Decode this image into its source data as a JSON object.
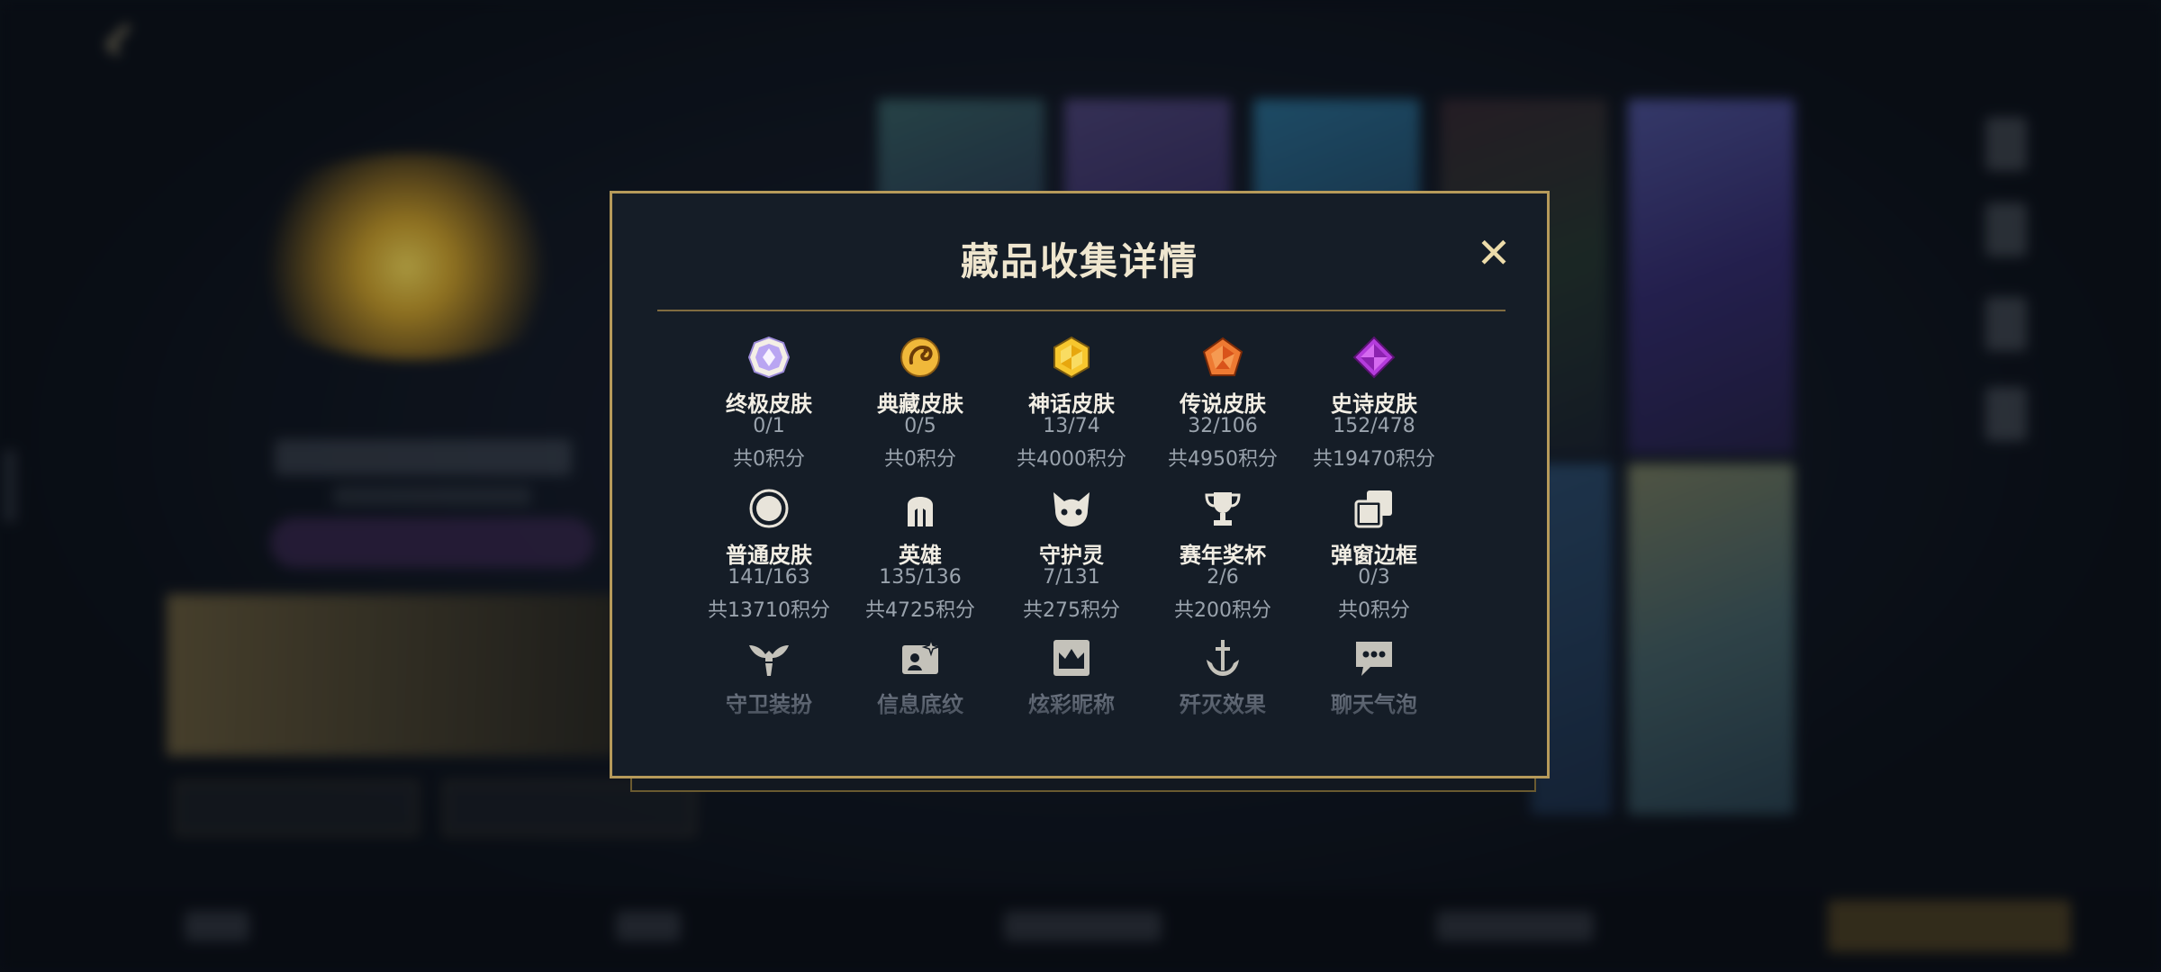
{
  "modal": {
    "title": "藏品收集详情",
    "close_symbol": "✕"
  },
  "categories": [
    {
      "name": "终极皮肤",
      "count": "0/1",
      "points": "共0积分",
      "icon": "ultimate-skin-icon",
      "color": "#c9b6ff"
    },
    {
      "name": "典藏皮肤",
      "count": "0/5",
      "points": "共0积分",
      "icon": "collection-skin-icon",
      "color": "#e0a533"
    },
    {
      "name": "神话皮肤",
      "count": "13/74",
      "points": "共4000积分",
      "icon": "mythic-skin-icon",
      "color": "#f2c12e"
    },
    {
      "name": "传说皮肤",
      "count": "32/106",
      "points": "共4950积分",
      "icon": "legendary-skin-icon",
      "color": "#e9672a"
    },
    {
      "name": "史诗皮肤",
      "count": "152/478",
      "points": "共19470积分",
      "icon": "epic-skin-icon",
      "color": "#b33ad8"
    },
    {
      "name": "普通皮肤",
      "count": "141/163",
      "points": "共13710积分",
      "icon": "normal-skin-icon",
      "color": "#e8e4da"
    },
    {
      "name": "英雄",
      "count": "135/136",
      "points": "共4725积分",
      "icon": "hero-helmet-icon",
      "color": "#e8e4da"
    },
    {
      "name": "守护灵",
      "count": "7/131",
      "points": "共275积分",
      "icon": "guardian-spirit-icon",
      "color": "#e8e4da"
    },
    {
      "name": "赛年奖杯",
      "count": "2/6",
      "points": "共200积分",
      "icon": "trophy-icon",
      "color": "#e8e4da"
    },
    {
      "name": "弹窗边框",
      "count": "0/3",
      "points": "共0积分",
      "icon": "popup-frame-icon",
      "color": "#e8e4da"
    },
    {
      "name": "守卫装扮",
      "count": "",
      "points": "",
      "icon": "ward-skin-icon",
      "color": "#d8d4ca"
    },
    {
      "name": "信息底纹",
      "count": "",
      "points": "",
      "icon": "info-card-icon",
      "color": "#d8d4ca"
    },
    {
      "name": "炫彩昵称",
      "count": "",
      "points": "",
      "icon": "crown-nickname-icon",
      "color": "#d8d4ca"
    },
    {
      "name": "歼灭效果",
      "count": "",
      "points": "",
      "icon": "anchor-effect-icon",
      "color": "#d8d4ca"
    },
    {
      "name": "聊天气泡",
      "count": "",
      "points": "",
      "icon": "chat-bubble-icon",
      "color": "#d8d4ca"
    }
  ],
  "colors": {
    "modal_border": "#b69a5a",
    "modal_bg": "#151d27",
    "accent": "#eddcaa"
  }
}
